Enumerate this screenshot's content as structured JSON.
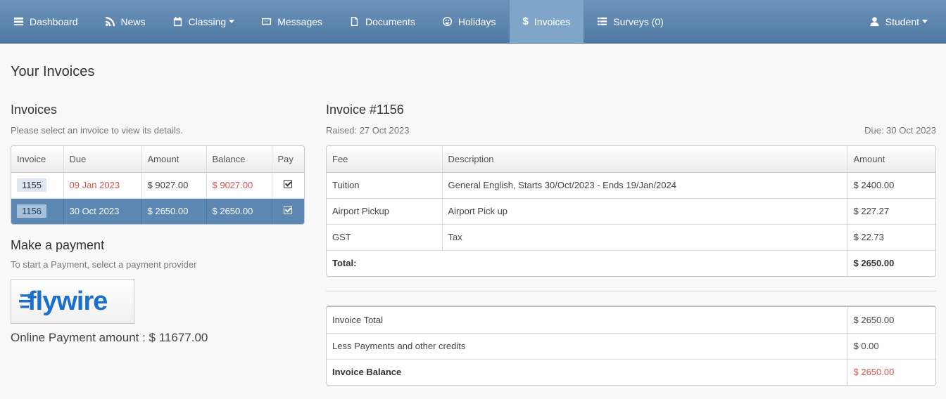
{
  "nav": {
    "items": [
      {
        "label": "Dashboard",
        "icon": "dashboard-icon"
      },
      {
        "label": "News",
        "icon": "rss-icon"
      },
      {
        "label": "Classing",
        "icon": "calendar-icon",
        "dropdown": true
      },
      {
        "label": "Messages",
        "icon": "envelope-icon"
      },
      {
        "label": "Documents",
        "icon": "document-icon"
      },
      {
        "label": "Holidays",
        "icon": "smiley-icon"
      },
      {
        "label": "Invoices",
        "icon": "dollar-icon",
        "active": true
      },
      {
        "label": "Surveys (0)",
        "icon": "list-icon"
      }
    ],
    "user": {
      "label": "Student",
      "icon": "user-icon"
    }
  },
  "page": {
    "title": "Your Invoices"
  },
  "invoices": {
    "title": "Invoices",
    "hint": "Please select an invoice to view its details.",
    "headers": [
      "Invoice",
      "Due",
      "Amount",
      "Balance",
      "Pay"
    ],
    "rows": [
      {
        "invoice": "1155",
        "due": "09 Jan 2023",
        "amount": "$ 9027.00",
        "balance": "$ 9027.00",
        "overdue": true
      },
      {
        "invoice": "1156",
        "due": "30 Oct 2023",
        "amount": "$ 2650.00",
        "balance": "$ 2650.00",
        "selected": true
      }
    ]
  },
  "payment": {
    "title": "Make a payment",
    "hint": "To start a Payment, select a payment provider",
    "provider": "flywire",
    "online_label": "Online Payment amount : $ 11677.00"
  },
  "detail": {
    "title": "Invoice #1156",
    "raised": "Raised: 27 Oct 2023",
    "due": "Due: 30 Oct 2023",
    "headers": [
      "Fee",
      "Description",
      "Amount"
    ],
    "rows": [
      {
        "fee": "Tuition",
        "description": "General English, Starts 30/Oct/2023 - Ends 19/Jan/2024",
        "amount": "$ 2400.00"
      },
      {
        "fee": "Airport Pickup",
        "description": "Airport Pick up",
        "amount": "$ 227.27"
      },
      {
        "fee": "GST",
        "description": "Tax",
        "amount": "$ 22.73"
      }
    ],
    "total_label": "Total:",
    "total_amount": "$ 2650.00"
  },
  "summary": {
    "rows": [
      {
        "label": "Invoice Total",
        "value": "$ 2650.00"
      },
      {
        "label": "Less Payments and other credits",
        "value": "$ 0.00"
      }
    ],
    "balance_label": "Invoice Balance",
    "balance_value": "$ 2650.00"
  },
  "colors": {
    "nav": "#5a84ae",
    "active": "#7fa6c9",
    "selected_row": "#5c87b2",
    "overdue": "#d9534f",
    "flywire": "#1a6fd0"
  }
}
